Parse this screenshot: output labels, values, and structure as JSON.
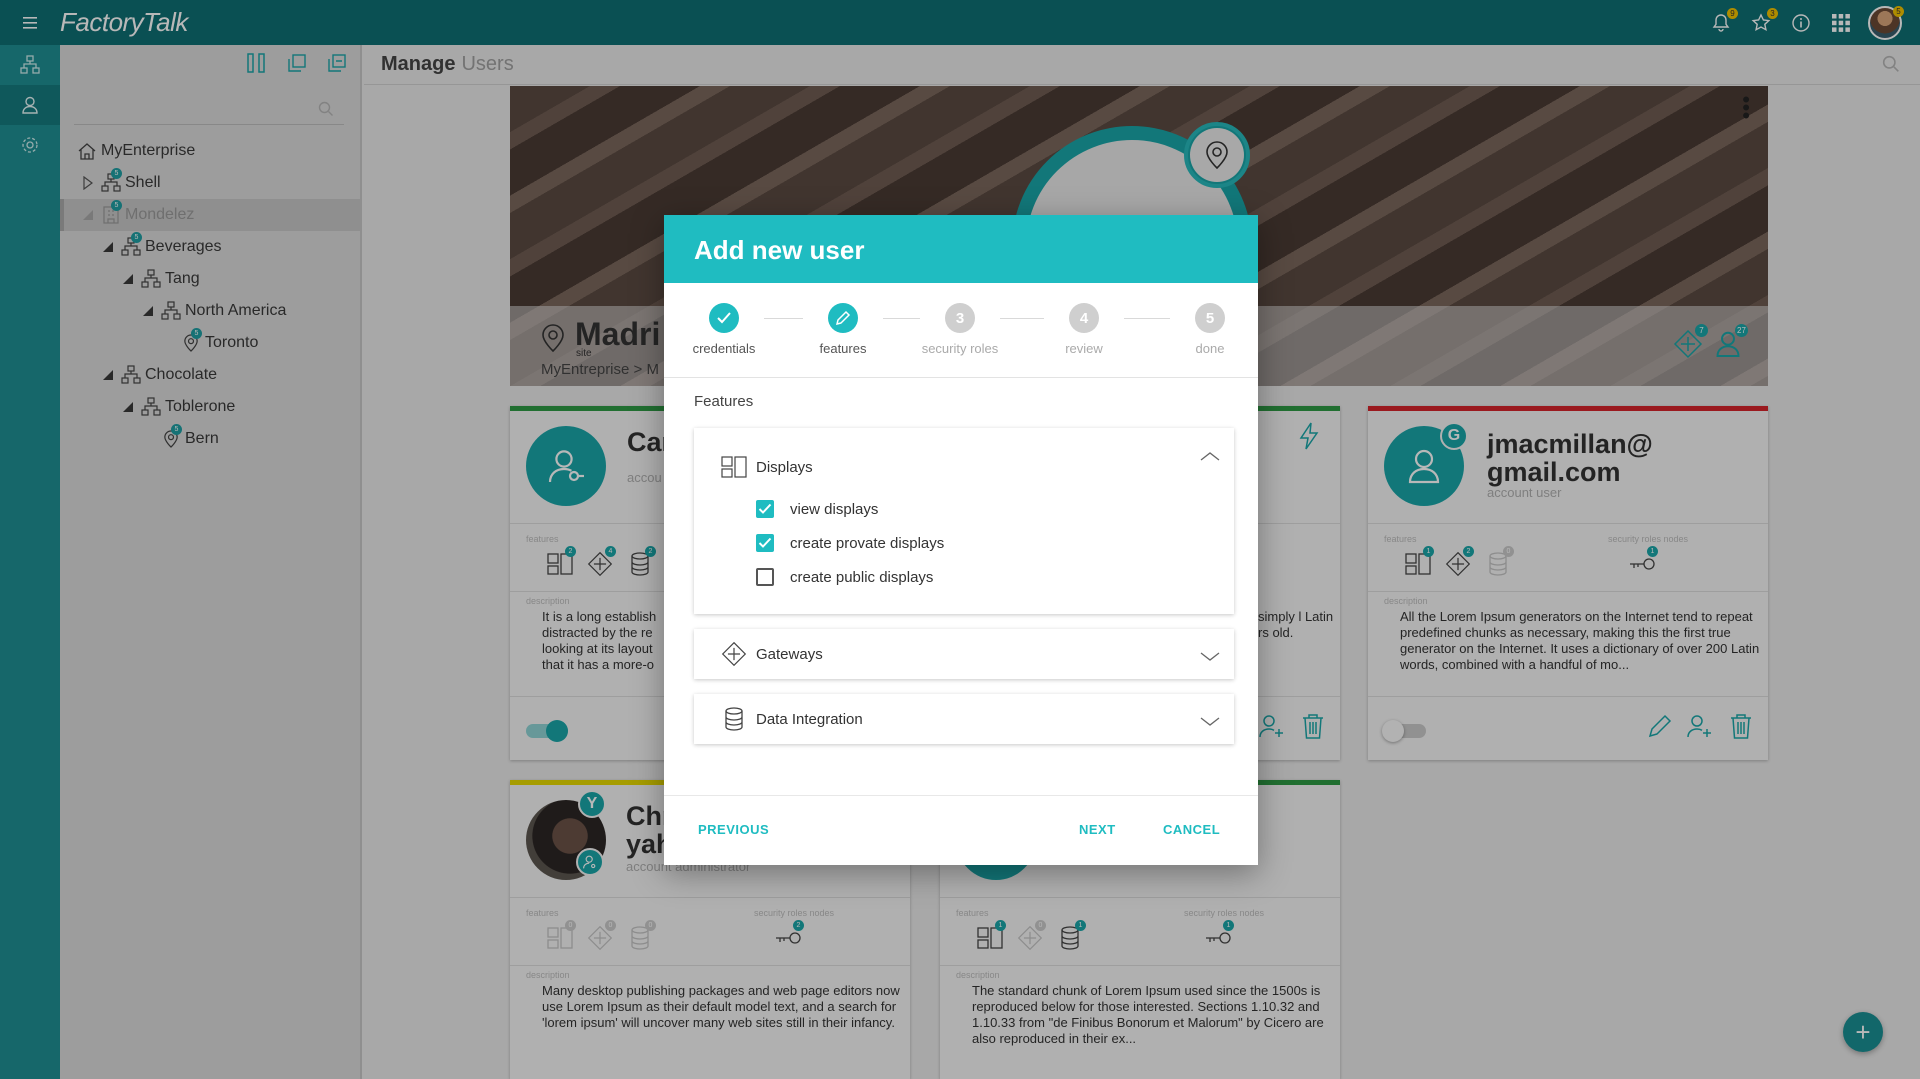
{
  "app": {
    "brand": "FactoryTalk"
  },
  "topbar": {
    "notifications_badge": "9",
    "favorites_badge": "3",
    "avatar_badge": "5"
  },
  "tree": {
    "search_placeholder": "",
    "items": [
      {
        "label": "MyEnterprise",
        "depth": 0,
        "icon": "home-icon",
        "caret": "none",
        "badge": ""
      },
      {
        "label": "Shell",
        "depth": 1,
        "icon": "hierarchy-icon",
        "caret": "collapsed",
        "badge": "5"
      },
      {
        "label": "Mondelez",
        "depth": 1,
        "icon": "building-icon",
        "caret": "expanded",
        "badge": "5",
        "selected": true
      },
      {
        "label": "Beverages",
        "depth": 2,
        "icon": "hierarchy-icon",
        "caret": "expanded",
        "badge": "5"
      },
      {
        "label": "Tang",
        "depth": 3,
        "icon": "hierarchy-icon",
        "caret": "expanded",
        "badge": ""
      },
      {
        "label": "North America",
        "depth": 4,
        "icon": "hierarchy-icon",
        "caret": "expanded",
        "badge": ""
      },
      {
        "label": "Toronto",
        "depth": 5,
        "icon": "pin-icon",
        "caret": "none",
        "badge": "5"
      },
      {
        "label": "Chocolate",
        "depth": 2,
        "icon": "hierarchy-icon",
        "caret": "expanded",
        "badge": ""
      },
      {
        "label": "Toblerone",
        "depth": 3,
        "icon": "hierarchy-icon",
        "caret": "expanded",
        "badge": ""
      },
      {
        "label": "Bern",
        "depth": 4,
        "icon": "pin-icon",
        "caret": "none",
        "badge": "5"
      }
    ]
  },
  "header": {
    "title_strong": "Manage",
    "title_light": "Users"
  },
  "hero": {
    "title": "Madri",
    "site_label": "site",
    "breadcrumb": "MyEntreprise > M",
    "stat_gateways": "7",
    "stat_users": "27"
  },
  "cards": {
    "card1": {
      "name": "Car",
      "role": "accou",
      "features_label": "features",
      "badges": [
        "2",
        "4",
        "2"
      ],
      "description_label": "description",
      "description": "It is a long establish distracted by the re looking at its layout that it has a more-o",
      "toggle_on": true
    },
    "card2": {
      "description": "simply l Latin rs old."
    },
    "card3": {
      "name_line1": "jmacmillan@",
      "name_line2": "gmail.com",
      "role": "account user",
      "avatar_letter": "G",
      "features_label": "features",
      "security_label": "security roles nodes",
      "badges": [
        "1",
        "2",
        "0"
      ],
      "security_badge": "1",
      "description_label": "description",
      "description": "All the Lorem Ipsum generators on the Internet tend to repeat predefined chunks as necessary, making this the first true generator on the Internet. It uses a dictionary of over 200 Latin words, combined with a handful of mo...",
      "toggle_on": false
    },
    "card4": {
      "name_line1": "Chr",
      "name_line2": "yah",
      "role": "account administrator",
      "avatar_letter": "Y",
      "features_label": "features",
      "security_label": "security roles nodes",
      "badges": [
        "0",
        "0",
        "0"
      ],
      "security_badge": "2",
      "description_label": "description",
      "description": "Many desktop publishing packages and web page editors now use Lorem Ipsum as their default model text, and a search for 'lorem ipsum' will uncover many web sites still in their infancy."
    },
    "card5": {
      "features_label": "features",
      "security_label": "security roles nodes",
      "badges": [
        "1",
        "0",
        "1"
      ],
      "security_badge": "1",
      "description_label": "description",
      "description": "The standard chunk of Lorem Ipsum used since the 1500s is reproduced below for those interested. Sections 1.10.32 and 1.10.33 from \"de Finibus Bonorum et Malorum\" by Cicero are also reproduced in their ex..."
    }
  },
  "dialog": {
    "title": "Add new user",
    "steps": [
      {
        "number": "1",
        "label": "credentials",
        "state": "done"
      },
      {
        "number": "2",
        "label": "features",
        "state": "current"
      },
      {
        "number": "3",
        "label": "security roles",
        "state": "todo"
      },
      {
        "number": "4",
        "label": "review",
        "state": "todo"
      },
      {
        "number": "5",
        "label": "done",
        "state": "todo"
      }
    ],
    "section_label": "Features",
    "panels": {
      "displays": {
        "label": "Displays",
        "expanded": true,
        "options": [
          {
            "label": "view displays",
            "checked": true
          },
          {
            "label": "create provate displays",
            "checked": true
          },
          {
            "label": "create public displays",
            "checked": false
          }
        ]
      },
      "gateways": {
        "label": "Gateways",
        "expanded": false
      },
      "data_integration": {
        "label": "Data Integration",
        "expanded": false
      }
    },
    "buttons": {
      "previous": "PREVIOUS",
      "next": "NEXT",
      "cancel": "CANCEL"
    }
  },
  "colors": {
    "topbar": "#0f6f73",
    "rail": "#1f8f93",
    "accent": "#1fbcc1",
    "teal": "#1aa6a8"
  }
}
